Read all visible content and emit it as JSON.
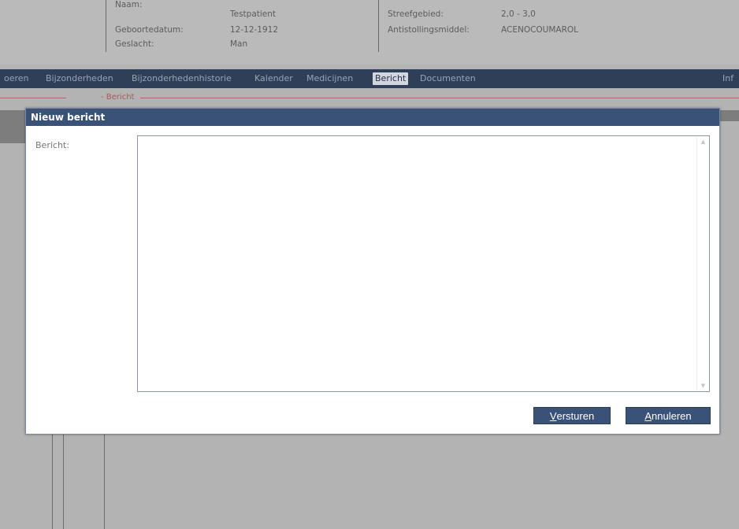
{
  "patient": {
    "name_label": "Naam:",
    "name_value": "Testpatient",
    "dob_label": "Geboortedatum:",
    "dob_value": "12-12-1912",
    "gender_label": "Geslacht:",
    "gender_value": "Man",
    "target_label": "Streefgebied:",
    "target_value": "2,0 - 3,0",
    "anticoag_label": "Antistollingsmiddel:",
    "anticoag_value": "ACENOCOUMAROL"
  },
  "nav": {
    "tabs": [
      {
        "label": "oeren"
      },
      {
        "label": "Bijzonderheden"
      },
      {
        "label": "Bijzonderhedenhistorie"
      },
      {
        "label": "Kalender"
      },
      {
        "label": "Medicijnen"
      },
      {
        "label": "Bericht"
      },
      {
        "label": "Documenten"
      },
      {
        "label": "Inf"
      }
    ],
    "active_tab": "Bericht"
  },
  "section": {
    "label": "Bericht"
  },
  "dialog": {
    "title": "Nieuw bericht",
    "field_label": "Bericht:",
    "message_value": "",
    "send_button": {
      "mnemonic": "V",
      "rest": "ersturen"
    },
    "cancel_button": {
      "mnemonic": "A",
      "rest": "nnuleren"
    }
  },
  "colors": {
    "nav_bg": "#2f3f58",
    "dialog_title_bg": "#3a5178",
    "button_bg": "#3a5178",
    "overlay_gray": "#b3b3b3",
    "section_accent": "#a85858"
  }
}
